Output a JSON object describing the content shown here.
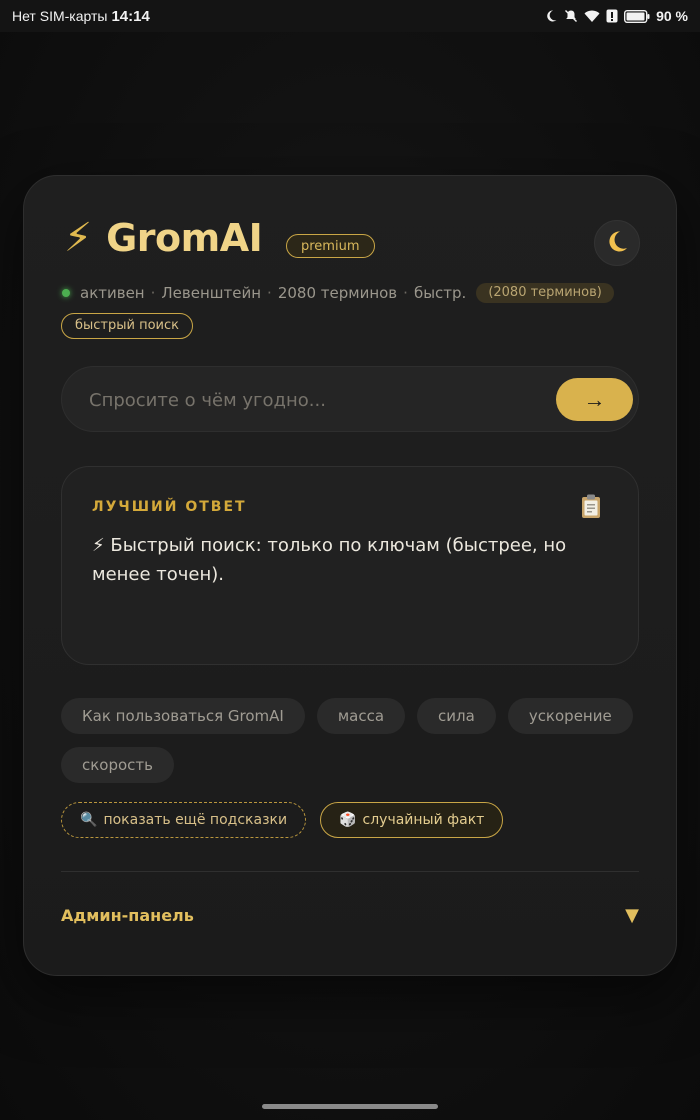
{
  "status_bar": {
    "carrier": "Нет SIM-карты",
    "time": "14:14",
    "battery": "90 %"
  },
  "header": {
    "bolt": "⚡",
    "title": "GromAI",
    "badge": "premium",
    "theme_icon": "moon-icon"
  },
  "status": {
    "state": "активен",
    "algorithm": "Левенштейн",
    "terms": "2080 терминов",
    "mode": "быстр.",
    "terms_badge": "(2080 терминов)",
    "mode_badge": "быстрый поиск"
  },
  "search": {
    "placeholder": "Спросите о чём угодно...",
    "submit": "→"
  },
  "answer": {
    "label": "ЛУЧШИЙ ОТВЕТ",
    "text": "⚡ Быстрый поиск: только по ключам (быстрее, но менее точен)."
  },
  "suggestions": [
    "Как пользоваться GromAI",
    "масса",
    "сила",
    "ускорение",
    "скорость"
  ],
  "actions": {
    "more_hints": "показать ещё подсказки",
    "more_hints_icon": "🔍",
    "random_fact": "случайный факт",
    "random_fact_icon": "🎲"
  },
  "admin": {
    "label": "Админ-панель",
    "arrow": "▼"
  },
  "colors": {
    "accent": "#d9b24d",
    "background": "#121212",
    "card": "#1e1e1e",
    "status_active": "#4caf50"
  }
}
